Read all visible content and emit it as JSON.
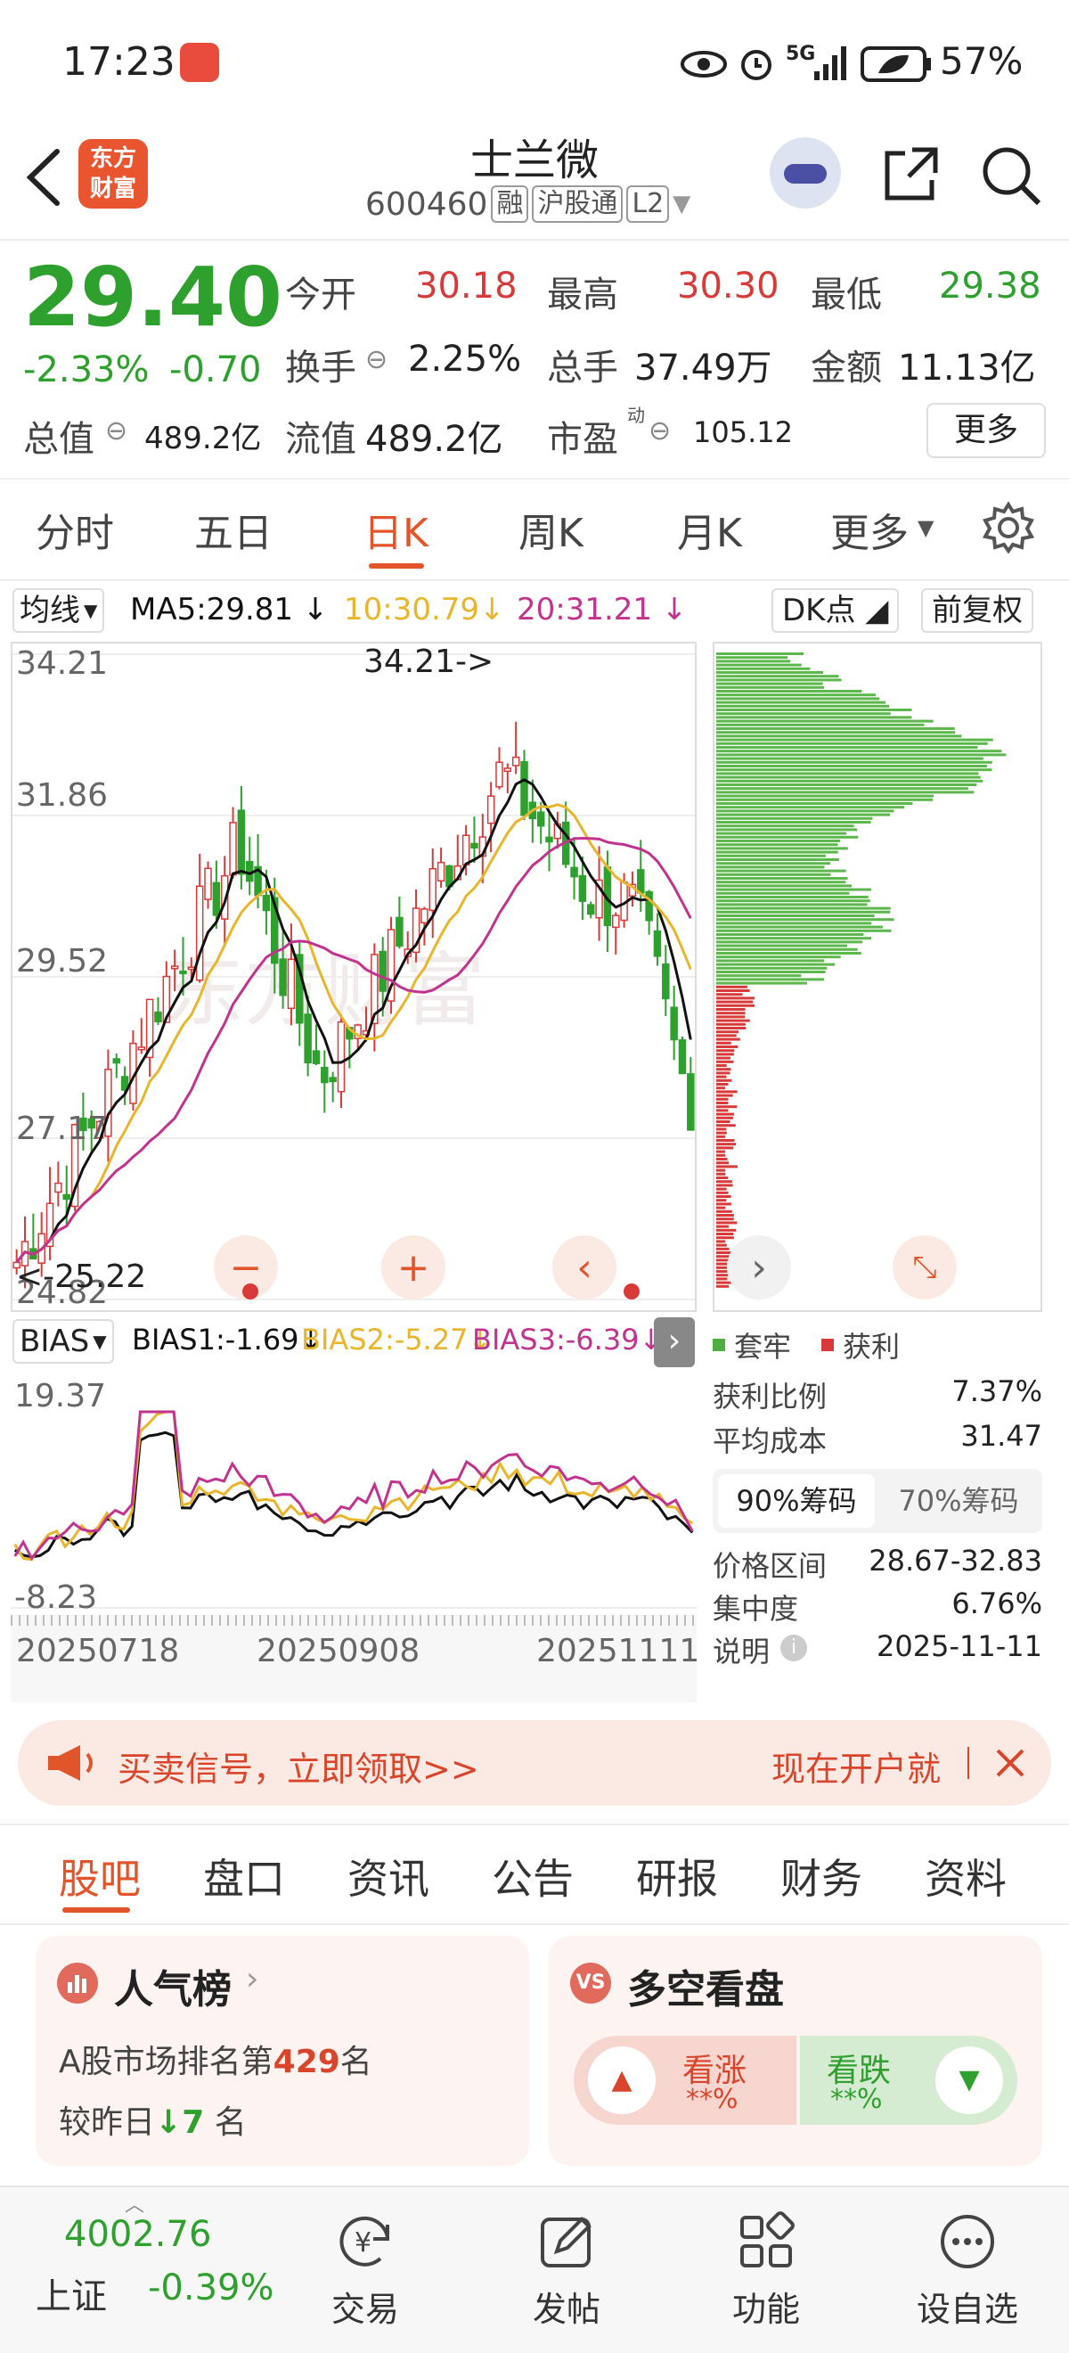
{
  "status_bar": {
    "time": "17:23",
    "battery": "57%",
    "network": "5G"
  },
  "header": {
    "stock_name": "士兰微",
    "stock_code": "600460",
    "tags": [
      "融",
      "沪股通",
      "L2"
    ],
    "brand": [
      "东方",
      "财富"
    ]
  },
  "quote": {
    "price": "29.40",
    "change_pct": "-2.33%",
    "change": "-0.70",
    "open_label": "今开",
    "open": "30.18",
    "high_label": "最高",
    "high": "30.30",
    "low_label": "最低",
    "low": "29.38",
    "turnover_label": "换手",
    "turnover": "2.25%",
    "volume_label": "总手",
    "volume": "37.49万",
    "amount_label": "金额",
    "amount": "11.13亿",
    "mktcap_label": "总值",
    "mktcap": "489.2亿",
    "float_label": "流值",
    "float": "489.2亿",
    "pe_label": "市盈",
    "pe_sup": "动",
    "pe": "105.12",
    "more_button": "更多"
  },
  "kline_tabs": [
    "分时",
    "五日",
    "日K",
    "周K",
    "月K",
    "更多"
  ],
  "kline_active_tab": "日K",
  "ma_bar": {
    "selector": "均线",
    "ma5": "MA5:29.81",
    "ma10": "10:30.79",
    "ma20": "20:31.21",
    "dk_button": "DK点",
    "adj_button": "前复权"
  },
  "price_axis": [
    "34.21",
    "31.86",
    "29.52",
    "27.17",
    "24.82"
  ],
  "max_marker": "34.21->",
  "min_marker": "<-25.22",
  "bias_bar": {
    "selector": "BIAS",
    "bias1": "BIAS1:-1.69",
    "bias2": "BIAS2:-5.27",
    "bias3": "BIAS3:-6.39",
    "axis_top": "19.37",
    "axis_bottom": "-8.23"
  },
  "date_axis": [
    "20250718",
    "20250908",
    "20251111"
  ],
  "chip": {
    "legend_trapped": "套牢",
    "legend_profit": "获利",
    "profit_ratio_label": "获利比例",
    "profit_ratio": "7.37%",
    "avg_cost_label": "平均成本",
    "avg_cost": "31.47",
    "tab90": "90%筹码",
    "tab70": "70%筹码",
    "range_label": "价格区间",
    "range": "28.67-32.83",
    "concentration_label": "集中度",
    "concentration": "6.76%",
    "note_label": "说明",
    "note_date": "2025-11-11"
  },
  "banner": {
    "text": "买卖信号，立即领取>>",
    "right_text": "现在开户就"
  },
  "bottom_tabs": [
    "股吧",
    "盘口",
    "资讯",
    "公告",
    "研报",
    "财务",
    "资料"
  ],
  "bottom_active_tab": "股吧",
  "popularity": {
    "title": "人气榜",
    "rank_prefix": "A股市场排名第",
    "rank": "429",
    "rank_suffix": "名",
    "change_prefix": "较昨日",
    "change": "7",
    "change_suffix": "名"
  },
  "sentiment": {
    "title": "多空看盘",
    "bull_label": "看涨",
    "bull_value": "**%",
    "bear_label": "看跌",
    "bear_value": "**%"
  },
  "bottom_nav": {
    "index_value": "4002.76",
    "index_name": "上证",
    "index_change": "-0.39%",
    "trade": "交易",
    "post": "发帖",
    "functions": "功能",
    "watchlist": "设自选"
  },
  "colors": {
    "up": "#d83a3a",
    "down": "#2ea02e",
    "accent": "#e2552b",
    "ma5": "#111111",
    "ma10": "#e9b52c",
    "ma20": "#c2338f"
  }
}
